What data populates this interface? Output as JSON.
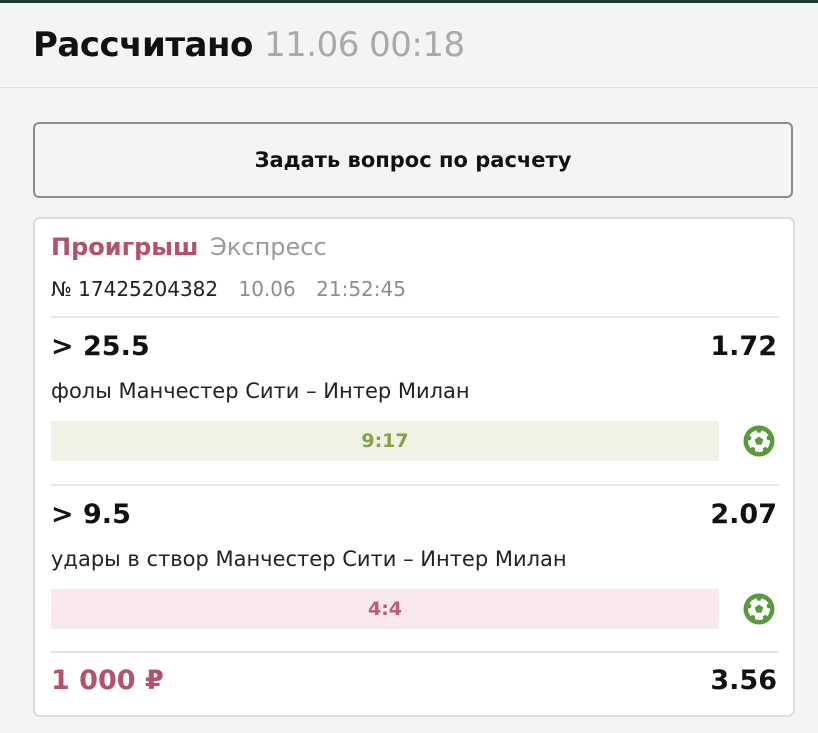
{
  "colors": {
    "loss": "#b5516d",
    "win_bar": "#eef3e6",
    "win_text": "#85a33d",
    "lose_bar": "#f8e8ed",
    "lose_text": "#bc5c77",
    "ball": "#5b9a3a"
  },
  "header": {
    "title": "Рассчитано",
    "datetime": "11.06 00:18"
  },
  "ask_button": {
    "label": "Задать вопрос по расчету"
  },
  "bet": {
    "status": "Проигрыш",
    "type": "Экспресс",
    "number": "№ 17425204382",
    "date": "10.06",
    "time": "21:52:45",
    "selections": [
      {
        "value": "> 25.5",
        "odds": "1.72",
        "market": "фолы Манчестер Сити – Интер Милан",
        "score": "9:17",
        "result": "win",
        "icon": "soccer-ball-icon"
      },
      {
        "value": "> 9.5",
        "odds": "2.07",
        "market": "удары в створ Манчестер Сити – Интер Милан",
        "score": "4:4",
        "result": "lose",
        "icon": "soccer-ball-icon"
      }
    ],
    "stake": "1 000 ₽",
    "total_odds": "3.56"
  }
}
